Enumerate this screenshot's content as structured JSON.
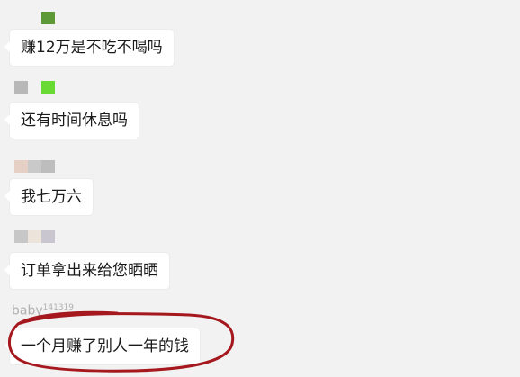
{
  "colors": {
    "background": "#f2f2f2",
    "bubble": "#ffffff",
    "text": "#1a1a1a",
    "nickname": "#b0b0b0",
    "annotation_circle": "#a5181d"
  },
  "messages": [
    {
      "text": "赚12万是不吃不喝吗",
      "avatar_pixels": [
        "#f2f2f2",
        "#f2f2f2",
        "#5d9a37"
      ]
    },
    {
      "text": "还有时间休息吗",
      "avatar_pixels": [
        "#b8b8b8",
        "#f2f2f2",
        "#69d933"
      ]
    },
    {
      "text": "我七万六",
      "avatar_pixels": [
        "#e6d0c6",
        "#c9c9c9",
        "#bdbdbd"
      ]
    },
    {
      "text": "订单拿出来给您晒晒",
      "avatar_pixels": [
        "#c7c7c7",
        "#ece4da",
        "#c9c6cf"
      ]
    },
    {
      "nickname": "baby",
      "nickname_suffix": "14131",
      "nickname_sup": "9",
      "text": "一个月赚了别人一年的钱"
    }
  ]
}
